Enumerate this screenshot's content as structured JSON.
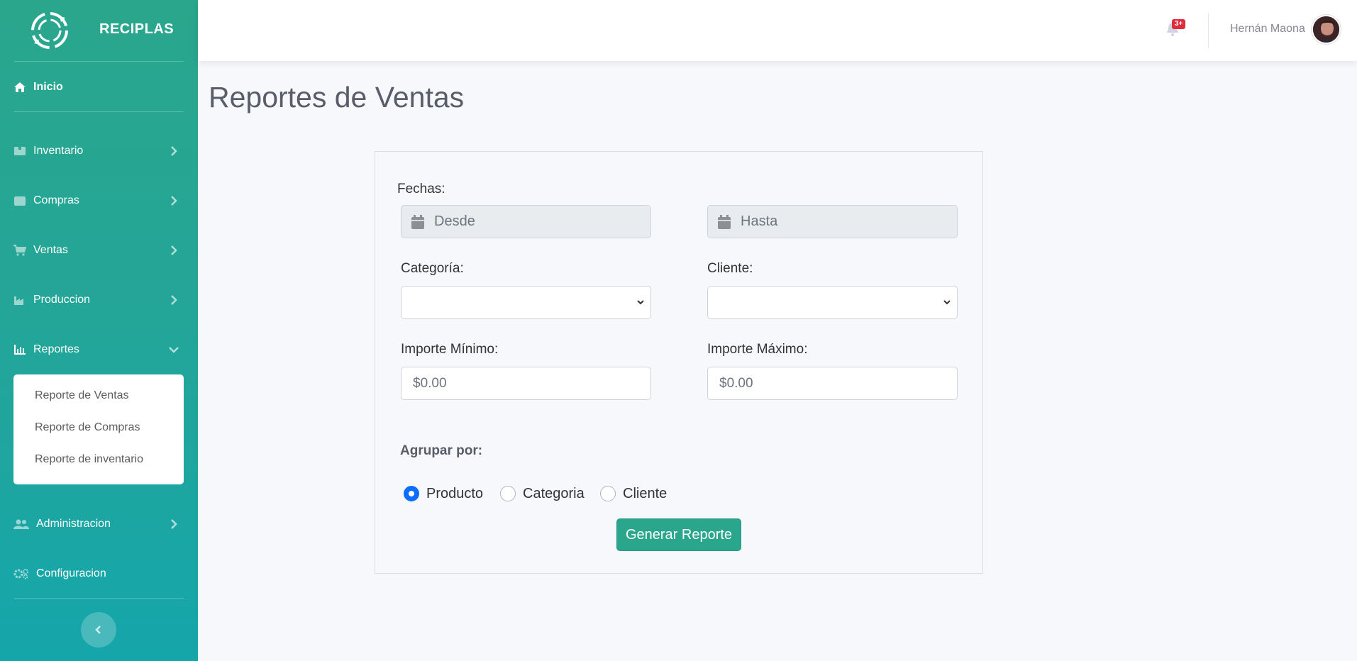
{
  "brand": {
    "name": "RECIPLAS",
    "logo_icon": "recycle-logo-icon"
  },
  "sidebar": {
    "home": {
      "label": "Inicio",
      "icon": "home-icon"
    },
    "items": [
      {
        "label": "Inventario",
        "icon": "box-icon"
      },
      {
        "label": "Compras",
        "icon": "card-icon"
      },
      {
        "label": "Ventas",
        "icon": "cart-icon"
      },
      {
        "label": "Produccion",
        "icon": "industry-icon"
      },
      {
        "label": "Reportes",
        "icon": "chart-icon"
      },
      {
        "label": "Administracion",
        "icon": "users-icon"
      },
      {
        "label": "Configuracion",
        "icon": "cogs-icon"
      }
    ],
    "submenu": [
      {
        "label": "Reporte de Ventas"
      },
      {
        "label": "Reporte de Compras"
      },
      {
        "label": "Reporte de inventario"
      }
    ]
  },
  "topbar": {
    "notification_badge": "3+",
    "user_name": "Hernán Maona"
  },
  "page": {
    "title": "Reportes de Ventas"
  },
  "form": {
    "dates_label": "Fechas:",
    "from_placeholder": "Desde",
    "to_placeholder": "Hasta",
    "category_label": "Categoría:",
    "client_label": "Cliente:",
    "min_label": "Importe Mínimo:",
    "max_label": "Importe Máximo:",
    "min_value": "$0.00",
    "max_value": "$0.00",
    "group_label": "Agrupar por:",
    "group_options": [
      {
        "label": "Producto",
        "checked": true
      },
      {
        "label": "Categoria",
        "checked": false
      },
      {
        "label": "Cliente",
        "checked": false
      }
    ],
    "submit_label": "Generar Reporte"
  },
  "colors": {
    "accent": "#2aa68c",
    "sidebar_bottom": "#15a6ab",
    "badge": "#e02d3c",
    "radio_checked": "#0d6efd"
  }
}
